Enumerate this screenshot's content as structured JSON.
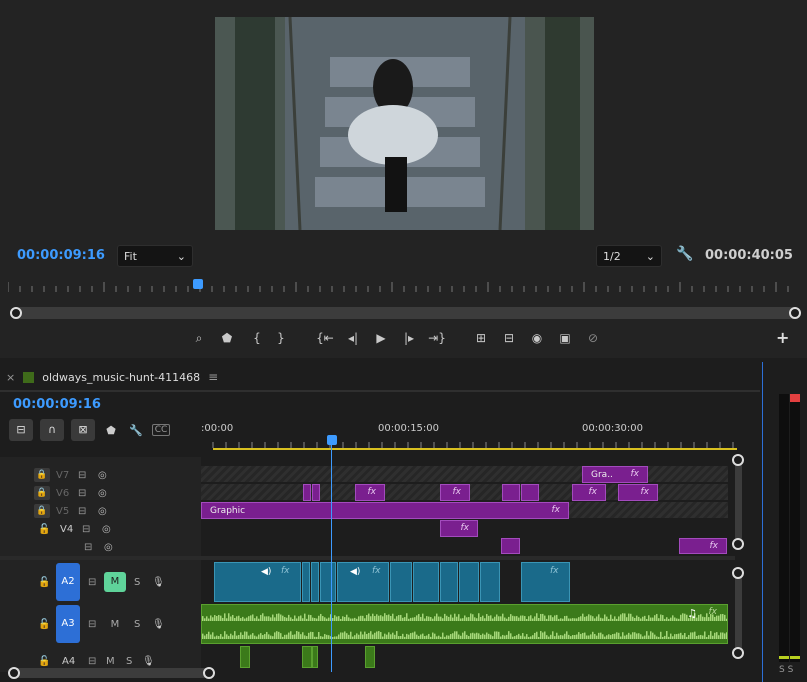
{
  "monitor": {
    "timecode": "00:00:09:16",
    "fit_label": "Fit",
    "resolution_label": "1/2",
    "duration": "00:00:40:05"
  },
  "timeline": {
    "close_label": "×",
    "sequence_name": "oldways_music-hunt-411468",
    "menu_label": "≡",
    "timecode": "00:00:09:16",
    "ruler": [
      ":00:00",
      "00:00:15:00",
      "00:00:30:00"
    ],
    "tracks": {
      "v7": "V7",
      "v6": "V6",
      "v5": "V5",
      "v4": "V4",
      "a2": "A2",
      "a3": "A3",
      "a4": "A4"
    },
    "mute_label": "M",
    "solo_label": "S",
    "cc_label": "CC",
    "clips": {
      "graphic": "Graphic",
      "gra": "Gra..",
      "fx": "fx"
    }
  },
  "meter": {
    "labels": "S S"
  },
  "colors": {
    "accent": "#3d9bff",
    "graphic_clip": "#7a1f8f",
    "video_clip": "#1a6a8a",
    "audio_clip": "#3b7a1a",
    "mute_active": "#5fd39a",
    "track_active": "#2d6fd6"
  }
}
